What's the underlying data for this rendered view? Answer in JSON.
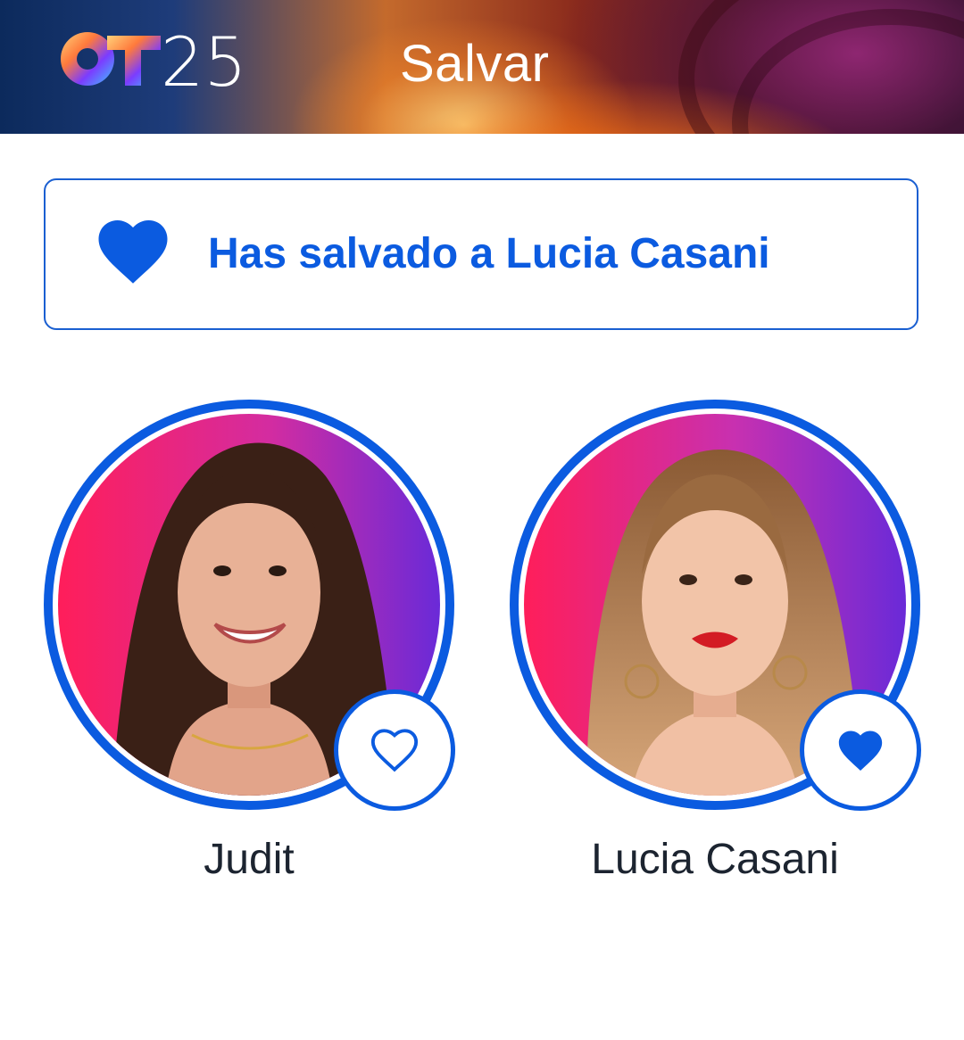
{
  "header": {
    "logo_text": "OT25",
    "title": "Salvar"
  },
  "banner": {
    "icon": "heart-filled-icon",
    "message": "Has salvado a Lucia Casani"
  },
  "contestants": [
    {
      "name": "Judit",
      "saved": false,
      "favorite_icon": "heart-outline-icon"
    },
    {
      "name": "Lucia Casani",
      "saved": true,
      "favorite_icon": "heart-filled-icon"
    }
  ],
  "colors": {
    "accent": "#0b5be0",
    "text": "#1c2430",
    "background": "#ffffff"
  }
}
